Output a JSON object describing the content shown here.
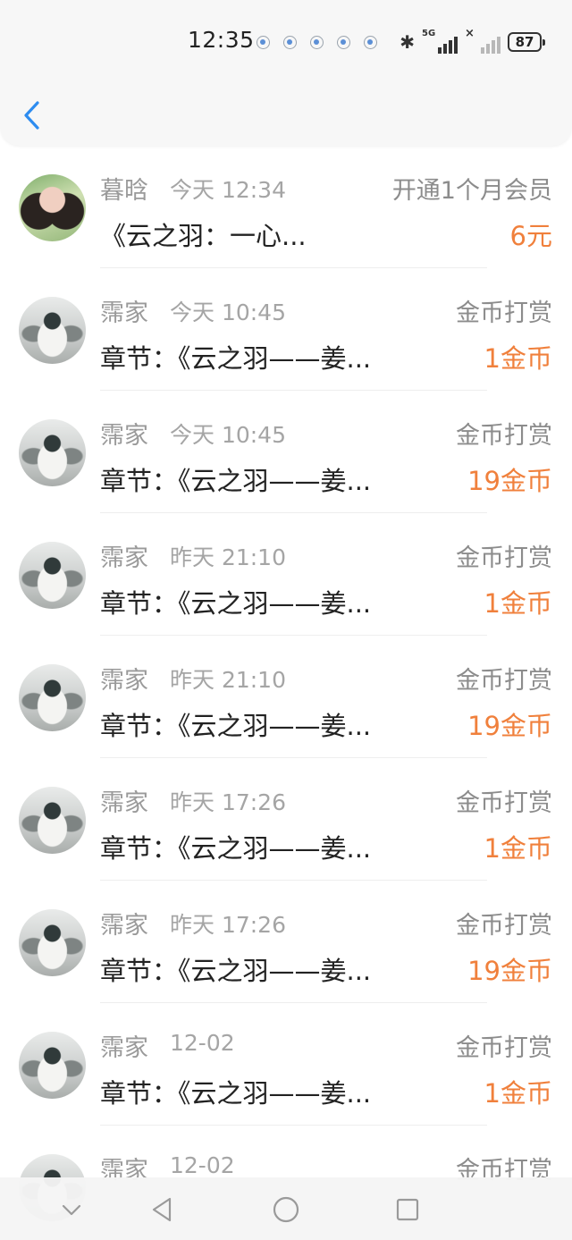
{
  "status_bar": {
    "time": "12:35",
    "network": "5G",
    "battery": "87"
  },
  "header": {
    "back_icon": "chevron-left-icon",
    "accent": "#2d8cf0"
  },
  "colors": {
    "amount": "#f0803c",
    "secondary_text": "#9a9a9a"
  },
  "records": [
    {
      "name": "暮晗",
      "time": "今天 12:34",
      "type": "开通1个月会员",
      "title": "《云之羽：一心...",
      "amount": "6元",
      "avatar": "photo"
    },
    {
      "name": "霈家",
      "time": "今天 10:45",
      "type": "金币打赏",
      "title": "章节：《云之羽——姜...",
      "amount": "1金币",
      "avatar": "art"
    },
    {
      "name": "霈家",
      "time": "今天 10:45",
      "type": "金币打赏",
      "title": "章节：《云之羽——姜...",
      "amount": "19金币",
      "avatar": "art"
    },
    {
      "name": "霈家",
      "time": "昨天 21:10",
      "type": "金币打赏",
      "title": "章节：《云之羽——姜...",
      "amount": "1金币",
      "avatar": "art"
    },
    {
      "name": "霈家",
      "time": "昨天 21:10",
      "type": "金币打赏",
      "title": "章节：《云之羽——姜...",
      "amount": "19金币",
      "avatar": "art"
    },
    {
      "name": "霈家",
      "time": "昨天 17:26",
      "type": "金币打赏",
      "title": "章节：《云之羽——姜...",
      "amount": "1金币",
      "avatar": "art"
    },
    {
      "name": "霈家",
      "time": "昨天 17:26",
      "type": "金币打赏",
      "title": "章节：《云之羽——姜...",
      "amount": "19金币",
      "avatar": "art"
    },
    {
      "name": "霈家",
      "time": "12-02",
      "type": "金币打赏",
      "title": "章节：《云之羽——姜...",
      "amount": "1金币",
      "avatar": "art"
    },
    {
      "name": "霈家",
      "time": "12-02",
      "type": "金币打赏",
      "title": "",
      "amount": "",
      "avatar": "art"
    }
  ],
  "nav_bar": {
    "icons": [
      "chevron-down-icon",
      "back-triangle-icon",
      "home-circle-icon",
      "recents-square-icon"
    ]
  }
}
